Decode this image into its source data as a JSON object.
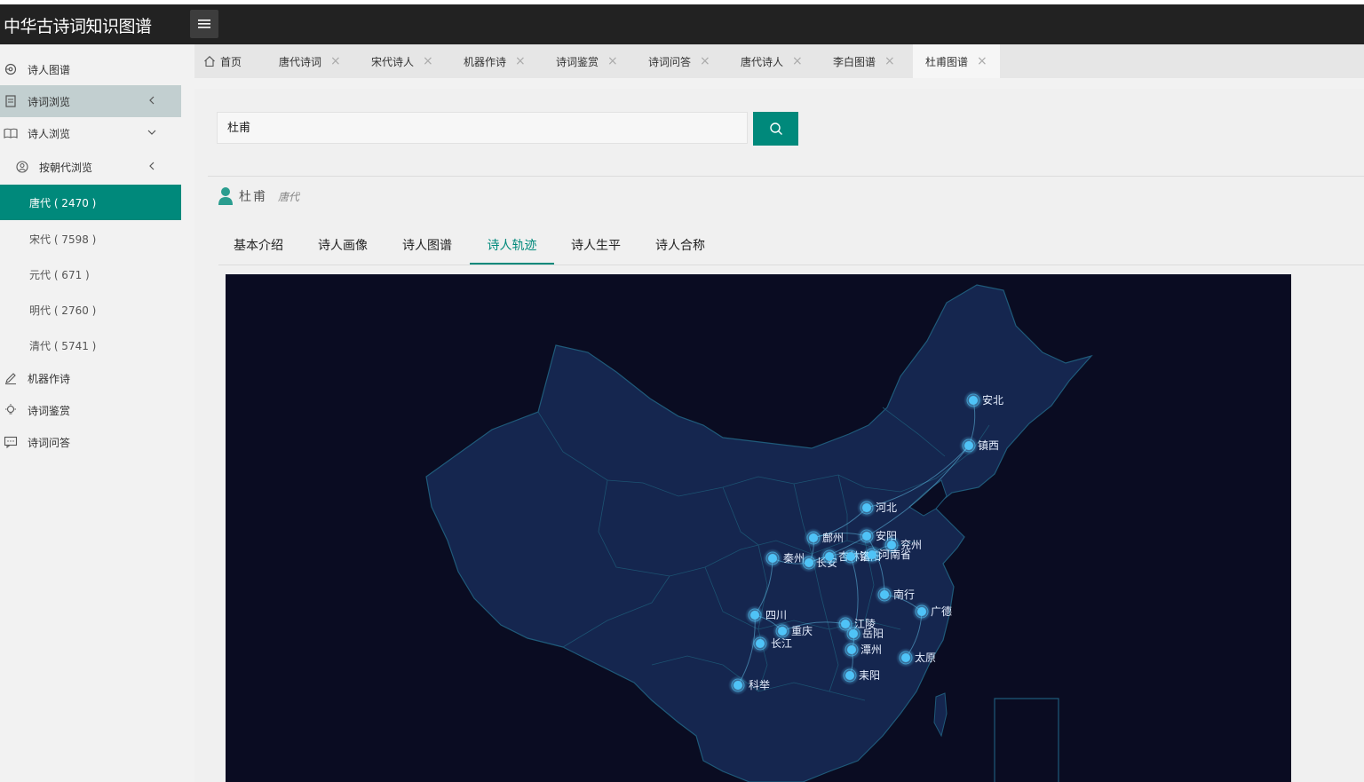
{
  "app": {
    "title": "中华古诗词知识图谱"
  },
  "sidebar": {
    "items": [
      {
        "label": "诗人图谱",
        "icon": "graph-icon"
      },
      {
        "label": "诗词浏览",
        "icon": "book-icon"
      },
      {
        "label": "诗人浏览",
        "icon": "open-book-icon"
      },
      {
        "label": "按朝代浏览",
        "icon": "user-circle-icon"
      },
      {
        "label": "唐代 ( 2470 )"
      },
      {
        "label": "宋代 ( 7598 )"
      },
      {
        "label": "元代 ( 671 )"
      },
      {
        "label": "明代 ( 2760 )"
      },
      {
        "label": "清代 ( 5741 )"
      },
      {
        "label": "机器作诗",
        "icon": "pen-icon"
      },
      {
        "label": "诗词鉴赏",
        "icon": "bulb-icon"
      },
      {
        "label": "诗词问答",
        "icon": "chat-icon"
      }
    ]
  },
  "tabs": [
    {
      "label": "首页",
      "icon": "home-icon"
    },
    {
      "label": "唐代诗词"
    },
    {
      "label": "宋代诗人"
    },
    {
      "label": "机器作诗"
    },
    {
      "label": "诗词鉴赏"
    },
    {
      "label": "诗词问答"
    },
    {
      "label": "唐代诗人"
    },
    {
      "label": "李白图谱"
    },
    {
      "label": "杜甫图谱"
    }
  ],
  "tab_close": "×",
  "search": {
    "value": "杜甫"
  },
  "poet": {
    "name": "杜甫",
    "dynasty": "唐代"
  },
  "subtabs": [
    "基本介绍",
    "诗人画像",
    "诗人图谱",
    "诗人轨迹",
    "诗人生平",
    "诗人合称"
  ],
  "active_subtab": "诗人轨迹",
  "map": {
    "cities": [
      "安北",
      "镇西",
      "河北",
      "鄜州",
      "安阳",
      "兖州",
      "秦州",
      "长安",
      "杏林镇",
      "洛阳",
      "河南省",
      "南行",
      "广德",
      "四川",
      "重庆",
      "江陵",
      "岳阳",
      "长江",
      "潭州",
      "太原",
      "耒阳",
      "科举"
    ],
    "colors": {
      "land": "#15264f",
      "border": "#1f5a7a",
      "point": "#4fc3f7",
      "line": "#5fb8e0"
    }
  }
}
